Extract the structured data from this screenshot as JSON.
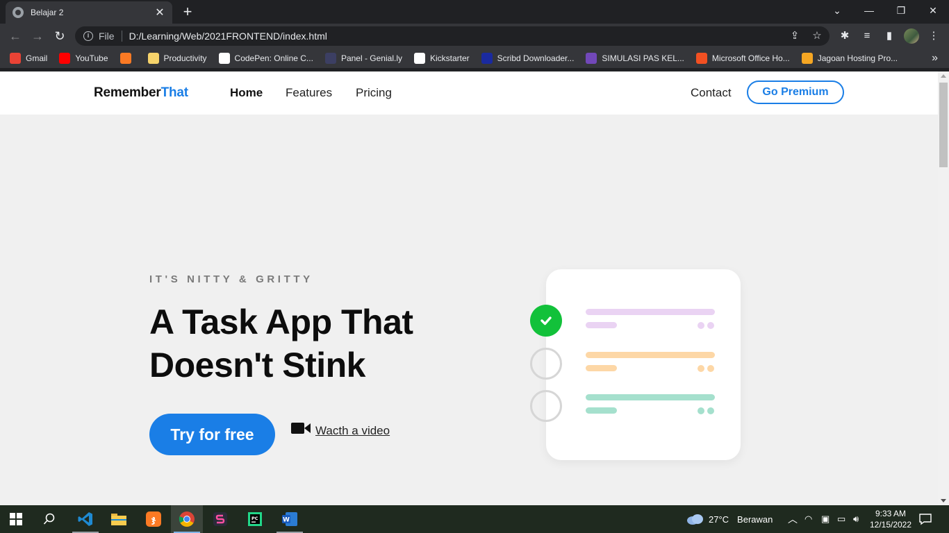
{
  "browser": {
    "tab_title": "Belajar 2",
    "url_scheme": "File",
    "url": "D:/Learning/Web/2021FRONTEND/index.html",
    "bookmarks": [
      {
        "label": "Gmail",
        "icon": "gmail-icon",
        "color": "#ea4335"
      },
      {
        "label": "YouTube",
        "icon": "youtube-icon",
        "color": "#ff0000"
      },
      {
        "label": "",
        "icon": "xampp-icon",
        "color": "#fb7a24"
      },
      {
        "label": "Productivity",
        "icon": "folder-icon",
        "color": "#f6d36b"
      },
      {
        "label": "CodePen: Online C...",
        "icon": "codepen-icon",
        "color": "#ffffff"
      },
      {
        "label": "Panel - Genial.ly",
        "icon": "genially-icon",
        "color": "#3c3f63"
      },
      {
        "label": "Kickstarter",
        "icon": "kickstarter-icon",
        "color": "#ffffff"
      },
      {
        "label": "Scribd Downloader...",
        "icon": "scribd-icon",
        "color": "#1a2a9f"
      },
      {
        "label": "SIMULASI PAS KEL...",
        "icon": "forms-icon",
        "color": "#7248b9"
      },
      {
        "label": "Microsoft Office Ho...",
        "icon": "microsoft-icon",
        "color": "#f25022"
      },
      {
        "label": "Jagoan Hosting Pro...",
        "icon": "jagoan-icon",
        "color": "#f5a623"
      }
    ]
  },
  "site": {
    "logo_main": "Remember",
    "logo_accent": "That",
    "nav": [
      "Home",
      "Features",
      "Pricing"
    ],
    "contact": "Contact",
    "premium": "Go Premium",
    "eyebrow": "IT'S NITTY & GRITTY",
    "headline_line1": "A Task App That",
    "headline_line2": "Doesn't Stink",
    "cta": "Try for free",
    "video_link": "Wacth a video",
    "accent_color": "#1a7ee6",
    "tasks": [
      {
        "done": true,
        "color": "#ead3f3"
      },
      {
        "done": false,
        "color": "#fdd7a6"
      },
      {
        "done": false,
        "color": "#a5e0cd"
      }
    ]
  },
  "taskbar": {
    "weather": "27°C",
    "weather_text": "Berawan",
    "time": "9:33 AM",
    "date": "12/15/2022"
  }
}
